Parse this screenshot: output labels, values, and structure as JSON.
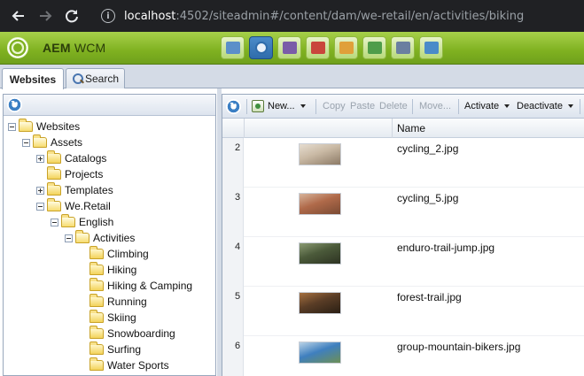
{
  "browser": {
    "back_icon": "arrow-left-icon",
    "forward_icon": "arrow-right-icon",
    "reload_icon": "reload-icon",
    "url_host": "localhost",
    "url_rest": ":4502/siteadmin#/content/dam/we-retail/en/activities/biking"
  },
  "header": {
    "brand": "AEM",
    "product": "WCM",
    "app_icons": [
      {
        "name": "sites-icon",
        "color": "#5b8fc9"
      },
      {
        "name": "globe-icon",
        "color": "#2f6cab",
        "active": true
      },
      {
        "name": "camera-icon",
        "color": "#7a5ca8"
      },
      {
        "name": "megaphone-icon",
        "color": "#c9453b"
      },
      {
        "name": "mail-icon",
        "color": "#e0a03a"
      },
      {
        "name": "users-icon",
        "color": "#4f9d4a"
      },
      {
        "name": "gears-icon",
        "color": "#6a7fa0"
      },
      {
        "name": "tag-icon",
        "color": "#4a8bc9"
      }
    ]
  },
  "tabs": [
    {
      "label": "Websites",
      "active": true
    },
    {
      "label": "Search",
      "active": false
    }
  ],
  "tree": [
    {
      "label": "Websites",
      "level": 0,
      "expander": "minus"
    },
    {
      "label": "Assets",
      "level": 1,
      "expander": "minus"
    },
    {
      "label": "Catalogs",
      "level": 2,
      "expander": "plus"
    },
    {
      "label": "Projects",
      "level": 2,
      "expander": "none"
    },
    {
      "label": "Templates",
      "level": 2,
      "expander": "plus"
    },
    {
      "label": "We.Retail",
      "level": 2,
      "expander": "minus"
    },
    {
      "label": "English",
      "level": 3,
      "expander": "minus"
    },
    {
      "label": "Activities",
      "level": 4,
      "expander": "minus"
    },
    {
      "label": "Climbing",
      "level": 5,
      "expander": "none"
    },
    {
      "label": "Hiking",
      "level": 5,
      "expander": "none"
    },
    {
      "label": "Hiking & Camping",
      "level": 5,
      "expander": "none"
    },
    {
      "label": "Running",
      "level": 5,
      "expander": "none"
    },
    {
      "label": "Skiing",
      "level": 5,
      "expander": "none"
    },
    {
      "label": "Snowboarding",
      "level": 5,
      "expander": "none"
    },
    {
      "label": "Surfing",
      "level": 5,
      "expander": "none"
    },
    {
      "label": "Water Sports",
      "level": 5,
      "expander": "none"
    }
  ],
  "toolbar": {
    "new_label": "New...",
    "copy_label": "Copy",
    "paste_label": "Paste",
    "delete_label": "Delete",
    "move_label": "Move...",
    "activate_label": "Activate",
    "deactivate_label": "Deactivate"
  },
  "grid": {
    "name_header": "Name",
    "rows": [
      {
        "num": "2",
        "name": "cycling_2.jpg",
        "thumb": [
          "#c9b9a4",
          "#8c7a66",
          "#e6ddd0"
        ]
      },
      {
        "num": "3",
        "name": "cycling_5.jpg",
        "thumb": [
          "#b06a4a",
          "#7a4a33",
          "#d6b39a"
        ]
      },
      {
        "num": "4",
        "name": "enduro-trail-jump.jpg",
        "thumb": [
          "#4b5a3a",
          "#2d3322",
          "#8a9a72"
        ]
      },
      {
        "num": "5",
        "name": "forest-trail.jpg",
        "thumb": [
          "#5a3d26",
          "#2a1f14",
          "#a5703f"
        ]
      },
      {
        "num": "6",
        "name": "group-mountain-bikers.jpg",
        "thumb": [
          "#3f7fbf",
          "#6d8f55",
          "#b9d2e6"
        ]
      }
    ]
  }
}
